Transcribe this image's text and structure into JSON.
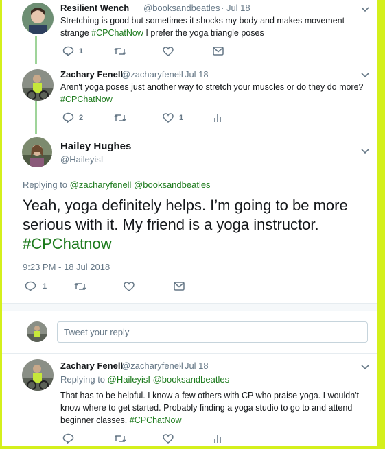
{
  "tweet1": {
    "name": "Resilient Wench",
    "handle": "@booksandbeatles",
    "date": "· Jul 18",
    "text": "Stretching is good but sometimes it shocks my body and makes movement strange ",
    "hashtag": "#CPChatNow",
    "text_after": " I prefer the yoga triangle poses",
    "reply_count": "1"
  },
  "tweet2": {
    "name": "Zachary Fenell",
    "handle": "@zacharyfenell",
    "date": "· Jul 18",
    "text": "Aren't yoga poses just another way to stretch your muscles or do they do more?",
    "hashtag": "#CPChatNow",
    "reply_count": "2",
    "like_count": "1"
  },
  "main": {
    "name": "Hailey Hughes",
    "handle": "@HaileyisI",
    "replying_label": "Replying to ",
    "replying_users": "@zacharyfenell @booksandbeatles",
    "text": "Yeah, yoga definitely helps. I’m going to be more serious with it. My friend is a yoga instructor. ",
    "hashtag": "#CPChatnow",
    "timestamp": "9:23 PM - 18 Jul 2018",
    "reply_count": "1"
  },
  "composer": {
    "placeholder": "Tweet your reply"
  },
  "tweet3": {
    "name": "Zachary Fenell",
    "handle": "@zacharyfenell",
    "date": "· Jul 18",
    "replying_label": "Replying to ",
    "replying_users": "@HaileyisI @booksandbeatles",
    "text": "That has to be helpful. I know a few others with CP who praise yoga. I wouldn't know where to get started. Probably finding a yoga studio to go to and attend beginner classes. ",
    "hashtag": "#CPChatNow"
  },
  "colors": {
    "accent_green": "#1c7a1c",
    "frame": "#d4f01c",
    "thread_line": "#9fd49a"
  },
  "icons": [
    "reply-icon",
    "retweet-icon",
    "like-icon",
    "message-icon",
    "analytics-icon",
    "caret-down-icon"
  ]
}
